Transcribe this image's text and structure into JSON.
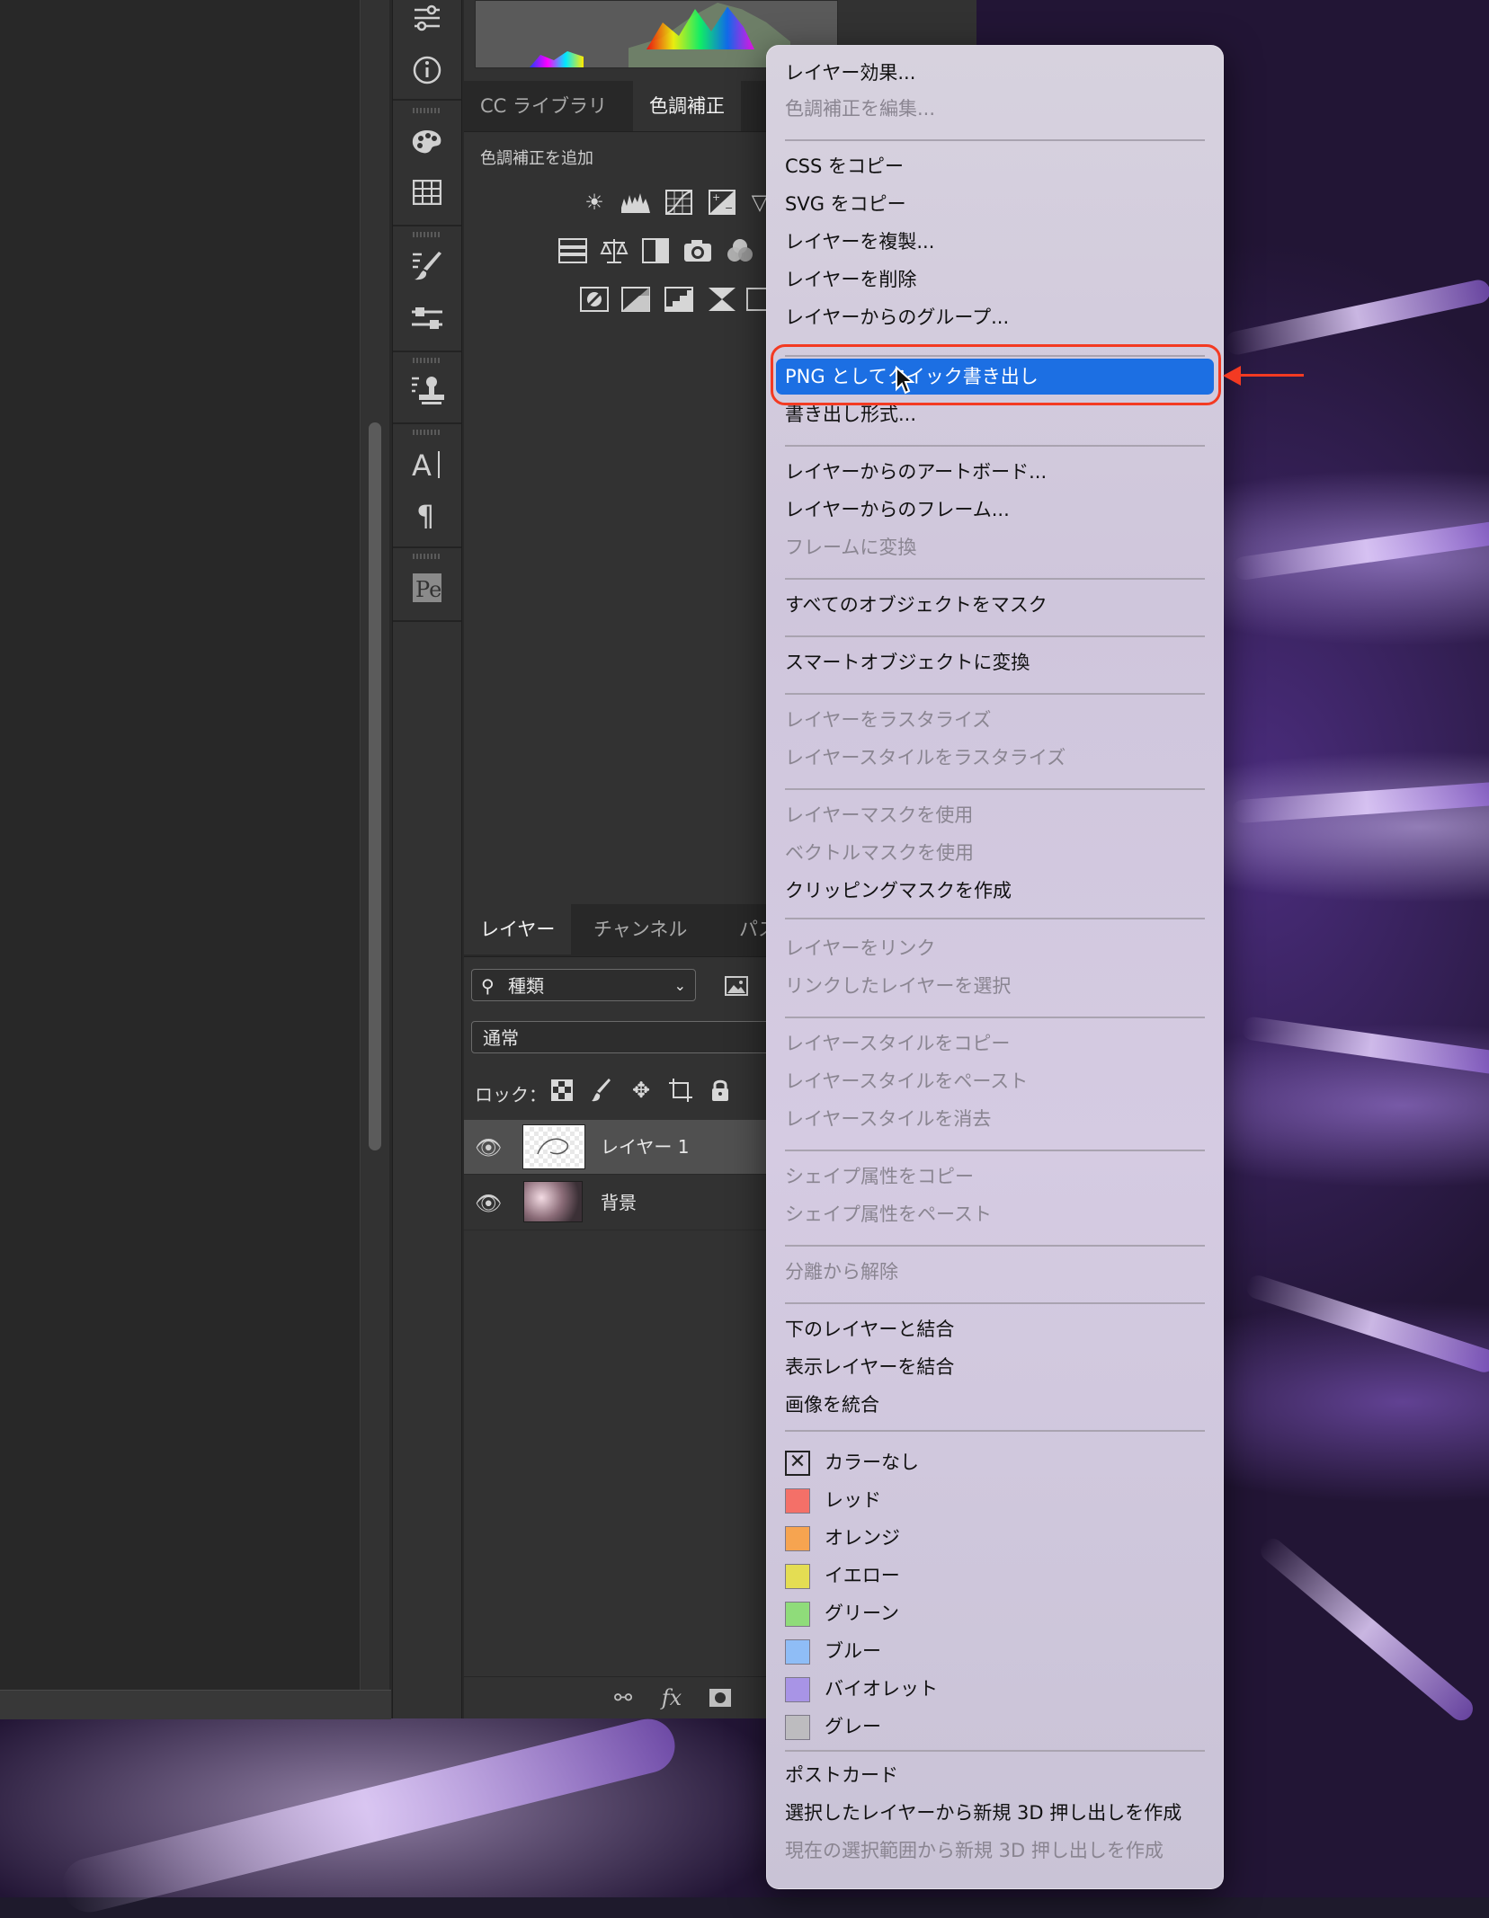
{
  "panels": {
    "tabs_top": [
      {
        "label": "CC ライブラリ"
      },
      {
        "label": "色調補正"
      }
    ],
    "adjustments_title": "色調補正を追加",
    "tabs_layers": [
      {
        "label": "レイヤー"
      },
      {
        "label": "チャンネル"
      },
      {
        "label": "パス"
      }
    ],
    "filter_dropdown": "種類",
    "blend_mode": "通常",
    "lock_label": "ロック：",
    "layers": [
      {
        "name": "レイヤー 1",
        "selected": true
      },
      {
        "name": "背景",
        "selected": false
      }
    ]
  },
  "context_menu": {
    "items": [
      {
        "label": "レイヤー効果...",
        "enabled": true
      },
      {
        "label": "色調補正を編集...",
        "enabled": false
      },
      {
        "label": "CSS をコピー",
        "enabled": true
      },
      {
        "label": "SVG をコピー",
        "enabled": true
      },
      {
        "label": "レイヤーを複製...",
        "enabled": true
      },
      {
        "label": "レイヤーを削除",
        "enabled": true
      },
      {
        "label": "レイヤーからのグループ...",
        "enabled": true
      },
      {
        "label": "PNG としてクイック書き出し",
        "enabled": true,
        "highlighted": true
      },
      {
        "label": "書き出し形式...",
        "enabled": true
      },
      {
        "label": "レイヤーからのアートボード...",
        "enabled": true
      },
      {
        "label": "レイヤーからのフレーム...",
        "enabled": true
      },
      {
        "label": "フレームに変換",
        "enabled": false
      },
      {
        "label": "すべてのオブジェクトをマスク",
        "enabled": true
      },
      {
        "label": "スマートオブジェクトに変換",
        "enabled": true
      },
      {
        "label": "レイヤーをラスタライズ",
        "enabled": false
      },
      {
        "label": "レイヤースタイルをラスタライズ",
        "enabled": false
      },
      {
        "label": "レイヤーマスクを使用",
        "enabled": false
      },
      {
        "label": "ベクトルマスクを使用",
        "enabled": false
      },
      {
        "label": "クリッピングマスクを作成",
        "enabled": true
      },
      {
        "label": "レイヤーをリンク",
        "enabled": false
      },
      {
        "label": "リンクしたレイヤーを選択",
        "enabled": false
      },
      {
        "label": "レイヤースタイルをコピー",
        "enabled": false
      },
      {
        "label": "レイヤースタイルをペースト",
        "enabled": false
      },
      {
        "label": "レイヤースタイルを消去",
        "enabled": false
      },
      {
        "label": "シェイプ属性をコピー",
        "enabled": false
      },
      {
        "label": "シェイプ属性をペースト",
        "enabled": false
      },
      {
        "label": "分離から解除",
        "enabled": false
      },
      {
        "label": "下のレイヤーと結合",
        "enabled": true
      },
      {
        "label": "表示レイヤーを結合",
        "enabled": true
      },
      {
        "label": "画像を統合",
        "enabled": true
      }
    ],
    "colors": [
      {
        "label": "カラーなし",
        "color": null
      },
      {
        "label": "レッド",
        "color": "#f47068"
      },
      {
        "label": "オレンジ",
        "color": "#f6a450"
      },
      {
        "label": "イエロー",
        "color": "#e4dd53"
      },
      {
        "label": "グリーン",
        "color": "#8fdc7a"
      },
      {
        "label": "ブルー",
        "color": "#8fbdf6"
      },
      {
        "label": "バイオレット",
        "color": "#a894e6"
      },
      {
        "label": "グレー",
        "color": "#bdbcbf"
      }
    ],
    "bottom_items": [
      {
        "label": "ポストカード",
        "enabled": true
      },
      {
        "label": "選択したレイヤーから新規 3D 押し出しを作成",
        "enabled": true
      },
      {
        "label": "現在の選択範囲から新規 3D 押し出しを作成",
        "enabled": false
      }
    ],
    "highlight_color": "#1c6fe3",
    "annotation_color": "#f33a22"
  }
}
